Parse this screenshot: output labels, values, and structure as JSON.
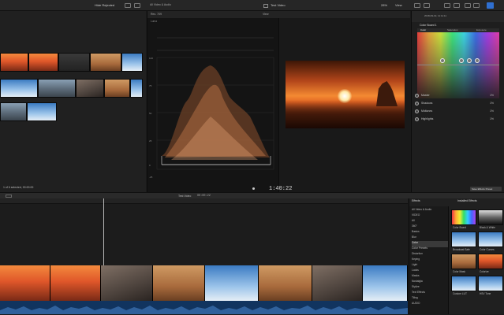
{
  "topbar": {
    "library_title": "Hide Rejected",
    "center_title": "All Video & Audio",
    "event_title": "Test Video",
    "zoom": "28%",
    "view": "View"
  },
  "browser": {
    "clip_count_label": "1 of 6 selected, 00:00:00"
  },
  "scopes": {
    "header_left": "Rec. 709",
    "header_right": "View",
    "channel": "Luma"
  },
  "scope_scale": [
    "100",
    "75",
    "50",
    "25",
    "0",
    "-25"
  ],
  "viewer": {
    "title": "Test Video",
    "zoom": "View"
  },
  "playback": {
    "timecode": "1:40:22"
  },
  "inspector": {
    "board": "Color Board 1",
    "tabs": [
      "Color",
      "Saturation",
      "Exposure"
    ],
    "params": [
      {
        "label": "Master",
        "value": "1%"
      },
      {
        "label": "Shadows",
        "value": "1%"
      },
      {
        "label": "Midtones",
        "value": "1%"
      },
      {
        "label": "Highlights",
        "value": "1%"
      }
    ],
    "top_label": "2018-09-19, 11:11:11"
  },
  "timeline": {
    "project": "Test Video",
    "duration": "00:00:22"
  },
  "effects": {
    "header": "Effects",
    "installed_header": "Installed Effects",
    "save_preset": "Save Effects Preset",
    "categories": [
      "All Video & Audio",
      "VIDEO",
      "All",
      "360°",
      "Basics",
      "Blur",
      "Color",
      "Color Presets",
      "Distortion",
      "Keying",
      "Light",
      "Looks",
      "Masks",
      "Nostalgia",
      "Stylize",
      "Text Effects",
      "Tiling",
      "AUDIO"
    ],
    "items": [
      {
        "label": "Color Board"
      },
      {
        "label": "Black & White"
      },
      {
        "label": "Broadcast Safe"
      },
      {
        "label": "Color Curves"
      },
      {
        "label": "Color Mask"
      },
      {
        "label": "Colorize"
      },
      {
        "label": "Custom LUT"
      },
      {
        "label": "HSV Tone"
      }
    ]
  },
  "colors": {
    "accent": "#3a7bd5",
    "audio_wave": "#5a8fd0",
    "timeline_clip_border": "#4da3ff"
  }
}
